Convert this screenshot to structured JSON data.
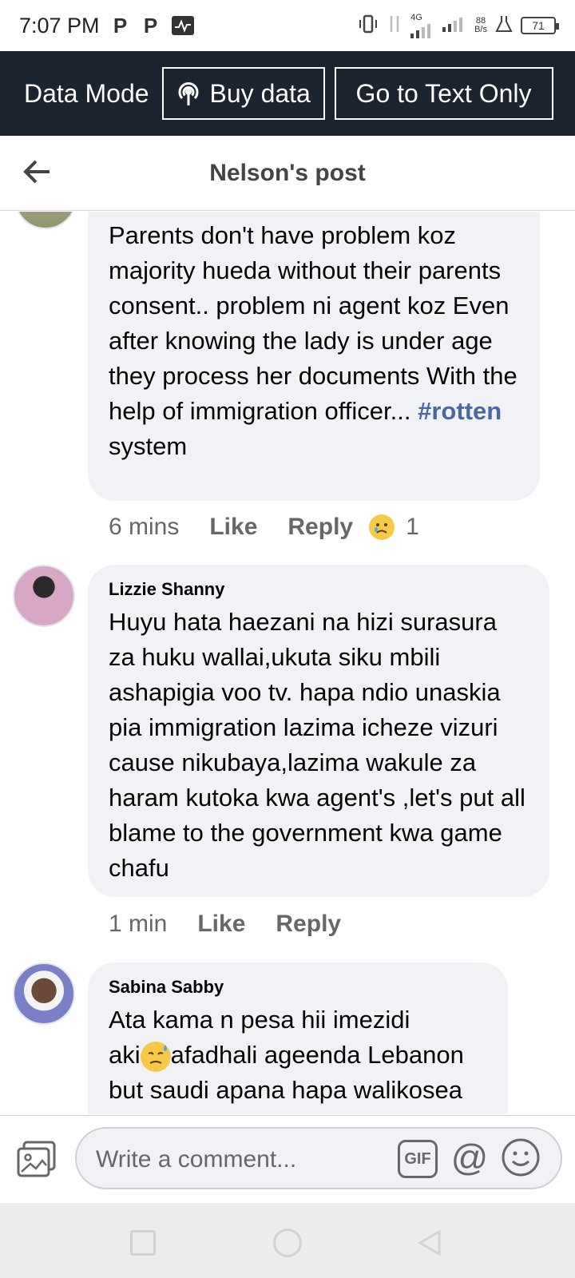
{
  "status_bar": {
    "time": "7:07 PM",
    "network": "4G",
    "speed_value": "88",
    "speed_unit": "B/s",
    "battery": "71"
  },
  "data_bar": {
    "mode_label": "Data Mode",
    "buy_label": "Buy data",
    "text_only_label": "Go to Text Only"
  },
  "header": {
    "title": "Nelson's post"
  },
  "comments": [
    {
      "author": "",
      "text_before_tag": "Parents don't have problem koz majority hueda without their parents consent.. problem ni agent koz Even after knowing the lady is under age they process her documents With the help of immigration officer...",
      "hashtag": "#rotten",
      "text_after_tag": "system",
      "time": "6 mins",
      "like_label": "Like",
      "reply_label": "Reply",
      "reaction_count": "1"
    },
    {
      "author": "Lizzie Shanny",
      "text": "Huyu hata haezani na hizi surasura za huku wallai,ukuta siku mbili ashapigia voo tv. hapa ndio unaskia pia immigration lazima icheze vizuri cause nikubaya,lazima wakule za haram kutoka kwa agent's ,let's put all blame to the government kwa game chafu",
      "time": "1 min",
      "like_label": "Like",
      "reply_label": "Reply"
    },
    {
      "author": "Sabina Sabby",
      "text_line1": "Ata kama n pesa hii imezidi",
      "text_line2_a": "aki",
      "text_line2_b": "afadhali ageenda Lebanon",
      "text_line3": "but saudi apana hapa walikosea"
    }
  ],
  "compose": {
    "placeholder": "Write a comment...",
    "gif_label": "GIF",
    "at_label": "@"
  },
  "colors": {
    "data_bar_bg": "#1c2430",
    "bubble_bg": "#f0f2f5",
    "hashtag": "#4b67a1",
    "muted_text": "#65676b"
  }
}
